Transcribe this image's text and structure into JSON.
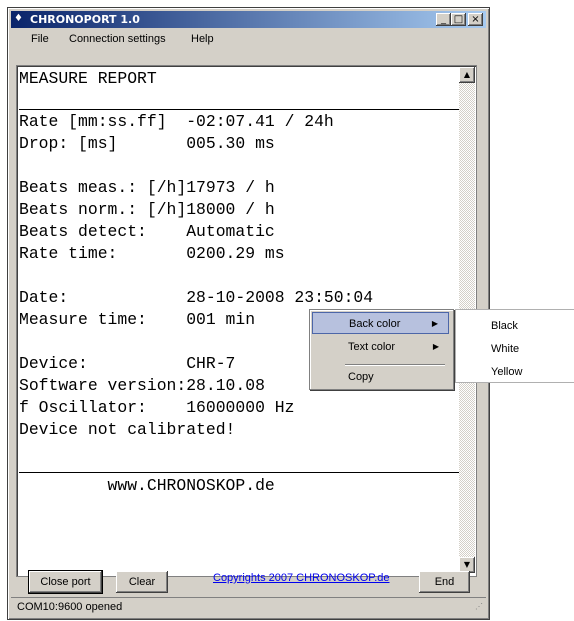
{
  "window": {
    "title": "CHRONOPORT 1.0",
    "controls": {
      "minimize": "_",
      "maximize": "□",
      "close": "×"
    }
  },
  "menu": [
    "File",
    "Connection settings",
    "Help"
  ],
  "report": {
    "lines": [
      "MEASURE REPORT",
      "Rate [mm:ss.ff]  -02:07.41 / 24h",
      "Drop: [ms]       005.30 ms",
      "Beats meas.: [/h]17973 / h",
      "Beats norm.: [/h]18000 / h",
      "Beats detect:    Automatic",
      "Rate time:       0200.29 ms",
      "Date:            28-10-2008 23:50:04",
      "Measure time:    001 min",
      "Device:          CHR-7",
      "Software version:28.10.08",
      "f Oscillator:    16000000 Hz",
      "Device not calibrated!",
      "         www.CHRONOSKOP.de"
    ]
  },
  "buttons": {
    "close_port": "Close port",
    "clear": "Clear",
    "end": "End"
  },
  "link": "Copyrights 2007 CHRONOSKOP.de",
  "status": "COM10:9600 opened",
  "context_menu": {
    "items": [
      "Back color",
      "Text color",
      "Copy"
    ],
    "submenu": [
      "Black",
      "White",
      "Yellow"
    ]
  },
  "colors": {
    "title_gradient_start": "#0a246a",
    "title_gradient_end": "#a6caf0",
    "face": "#d4d0c8",
    "highlight": "#b7c1de"
  }
}
